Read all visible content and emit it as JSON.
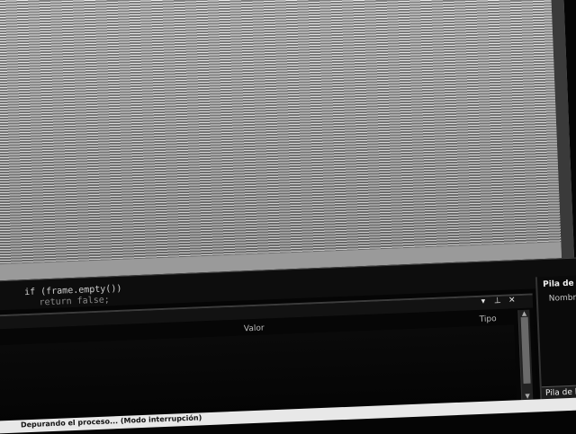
{
  "editor": {
    "code_line_1": "if (frame.empty())",
    "code_line_2": "return false;"
  },
  "locals_panel": {
    "column_valor": "Valor",
    "column_tipo": "Tipo",
    "tool_dropdown": "▾",
    "tool_pin": "⊥",
    "tool_close": "✕"
  },
  "callstack_panel": {
    "title": "Pila de llamadas",
    "column_nombre": "Nombre",
    "tab_label": "Pila de llama"
  },
  "status_bar": {
    "text": "Depurando el proceso... (Modo interrupción)"
  },
  "colors": {
    "background": "#050505",
    "image_light_line": "#f4f4f4",
    "image_dark_line": "#7a7a7a",
    "status_bar": "#e8e8e8"
  }
}
